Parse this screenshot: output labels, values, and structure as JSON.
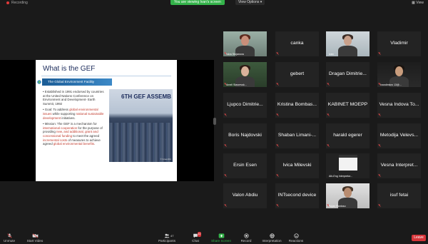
{
  "topbar": {
    "recording_label": "Recording",
    "share_banner": "You are viewing Ivan's screen",
    "view_options": "View Options ▾",
    "view_label": "View"
  },
  "slide": {
    "title": "What is the GEF",
    "facility_bar": "The Global Environment Facility",
    "bullet1": "Established in 1991 endorsed by countries at the United Nations Conference on Environment and Development- Earth Summit, 1992",
    "bullet2_pre": "Goal: To address ",
    "bullet2_red1": "global environmental issues",
    "bullet2_mid": " while supporting ",
    "bullet2_red2": "national sustainable development",
    "bullet2_post": " initiatives.",
    "bullet3_pre": "Mission: The GEF is a mechanism for ",
    "bullet3_red1": "international cooperation",
    "bullet3_mid1": " for the purpose of providing ",
    "bullet3_red2": "new, and additional, grant and concessional funding",
    "bullet3_mid2": " to meet the agreed ",
    "bullet3_red3": "incremental costs",
    "bullet3_mid3": " of measures to achieve agreed ",
    "bullet3_red4": "global environmental benefits",
    "bullet3_post": ".",
    "assembly_text": "6TH GEF ASSEMB",
    "photo_credit": "© GreenFin"
  },
  "participants": [
    {
      "id": "p1",
      "name": "",
      "label": "Iskra Stojanova",
      "video": true,
      "muted": true
    },
    {
      "id": "p2",
      "name": "canka",
      "label": "",
      "video": false,
      "muted": true
    },
    {
      "id": "p3",
      "name": "",
      "label": "ivan",
      "video": true,
      "muted": false,
      "highlight": true
    },
    {
      "id": "p4",
      "name": "Vladimir",
      "label": "",
      "video": false,
      "muted": true
    },
    {
      "id": "p5",
      "name": "",
      "label": "Ameli Stavrevsk...",
      "video": true,
      "muted": true
    },
    {
      "id": "p6",
      "name": "gebert",
      "label": "",
      "video": false,
      "muted": true
    },
    {
      "id": "p7",
      "name": "Dragan Dimitrie...",
      "label": "",
      "video": false,
      "muted": true
    },
    {
      "id": "p8",
      "name": "",
      "label": "Ivandimkov 13@...",
      "video": true,
      "muted": true
    },
    {
      "id": "p9",
      "name": "Ljupco Dimitrie...",
      "label": "",
      "video": false,
      "muted": true
    },
    {
      "id": "p10",
      "name": "Kristina Bombas...",
      "label": "",
      "video": false,
      "muted": true
    },
    {
      "id": "p11",
      "name": "KABINET MOEPP",
      "label": "",
      "video": false,
      "muted": true
    },
    {
      "id": "p12",
      "name": "Vesna Indova To...",
      "label": "",
      "video": false,
      "muted": true
    },
    {
      "id": "p13",
      "name": "Boris Najdovski",
      "label": "",
      "video": false,
      "muted": true
    },
    {
      "id": "p14",
      "name": "Shaban Limani-...",
      "label": "",
      "video": false,
      "muted": true
    },
    {
      "id": "p15",
      "name": "harald egerer",
      "label": "",
      "video": false,
      "muted": true
    },
    {
      "id": "p16",
      "name": "Metodija Velevs...",
      "label": "",
      "video": false,
      "muted": true
    },
    {
      "id": "p17",
      "name": "Ersin Esen",
      "label": "",
      "video": false,
      "muted": true
    },
    {
      "id": "p18",
      "name": "Ivica Milevski",
      "label": "",
      "video": false,
      "muted": true
    },
    {
      "id": "p19",
      "name": "",
      "label": "Alb-Eng Interpretor...",
      "video": true,
      "muted": false
    },
    {
      "id": "p20",
      "name": "Vesna Interpret...",
      "label": "",
      "video": false,
      "muted": true
    },
    {
      "id": "p21",
      "name": "Valon Abdiu",
      "label": "",
      "video": false,
      "muted": true
    },
    {
      "id": "p22",
      "name": "INTsecond device",
      "label": "",
      "video": false,
      "muted": true
    },
    {
      "id": "p23",
      "name": "",
      "label": "Bojan Rantoso",
      "video": true,
      "muted": true
    },
    {
      "id": "p24",
      "name": "isuf fetai",
      "label": "",
      "video": false,
      "muted": true
    }
  ],
  "toolbar": {
    "unmute": "Unmute",
    "start_video": "Start Video",
    "participants": "Participants",
    "participants_count": "47",
    "chat": "Chat",
    "chat_badge": "10",
    "share_screen": "Share Screen",
    "record": "Record",
    "interpretation": "Interpretation",
    "reactions": "Reactions",
    "leave": "Leave"
  },
  "colors": {
    "share_green": "#34b34a",
    "leave_red": "#d6353a",
    "active_speaker": "#b8d54b"
  }
}
